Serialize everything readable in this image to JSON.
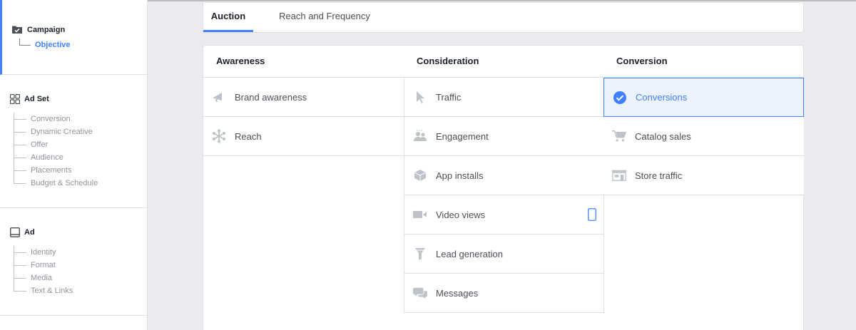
{
  "sidebar": {
    "campaign": {
      "title": "Campaign",
      "items": [
        {
          "label": "Objective"
        }
      ]
    },
    "adset": {
      "title": "Ad Set",
      "items": [
        {
          "label": "Conversion"
        },
        {
          "label": "Dynamic Creative"
        },
        {
          "label": "Offer"
        },
        {
          "label": "Audience"
        },
        {
          "label": "Placements"
        },
        {
          "label": "Budget & Schedule"
        }
      ]
    },
    "ad": {
      "title": "Ad",
      "items": [
        {
          "label": "Identity"
        },
        {
          "label": "Format"
        },
        {
          "label": "Media"
        },
        {
          "label": "Text & Links"
        }
      ]
    }
  },
  "tabs": [
    {
      "label": "Auction",
      "active": true
    },
    {
      "label": "Reach and Frequency",
      "active": false
    }
  ],
  "columns": [
    {
      "title": "Awareness",
      "objectives": [
        {
          "label": "Brand awareness",
          "icon": "megaphone-icon"
        },
        {
          "label": "Reach",
          "icon": "reach-asterisk-icon"
        }
      ]
    },
    {
      "title": "Consideration",
      "objectives": [
        {
          "label": "Traffic",
          "icon": "cursor-icon"
        },
        {
          "label": "Engagement",
          "icon": "people-icon"
        },
        {
          "label": "App installs",
          "icon": "box-icon"
        },
        {
          "label": "Video views",
          "icon": "video-camera-icon"
        },
        {
          "label": "Lead generation",
          "icon": "funnel-icon"
        },
        {
          "label": "Messages",
          "icon": "chat-bubbles-icon"
        }
      ]
    },
    {
      "title": "Conversion",
      "objectives": [
        {
          "label": "Conversions",
          "icon": "check-circle-icon",
          "selected": true
        },
        {
          "label": "Catalog sales",
          "icon": "cart-icon"
        },
        {
          "label": "Store traffic",
          "icon": "storefront-icon"
        }
      ]
    }
  ],
  "colors": {
    "accent": "#4080ff",
    "selected_bg": "#ecf3ff",
    "icon_gray": "#bec3c9"
  }
}
